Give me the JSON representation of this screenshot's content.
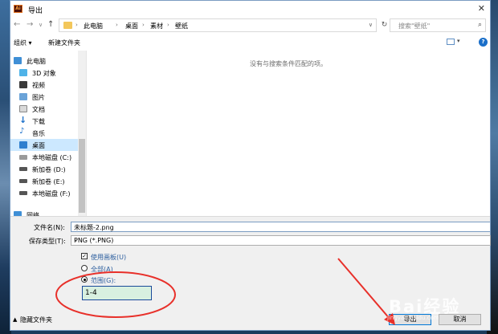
{
  "window": {
    "title": "导出",
    "app_icon": "Ai",
    "close_icon": "✕"
  },
  "address": {
    "crumbs": [
      "此电脑",
      "桌面",
      "素材",
      "壁纸"
    ],
    "search_placeholder": "搜索\"壁纸\""
  },
  "toolbar": {
    "organize": "组织 ▾",
    "new_folder": "新建文件夹"
  },
  "sidebar": {
    "items": [
      {
        "label": "此电脑",
        "icon": "computer-icon"
      },
      {
        "label": "3D 对象",
        "icon": "cube-icon"
      },
      {
        "label": "视频",
        "icon": "video-icon"
      },
      {
        "label": "图片",
        "icon": "picture-icon"
      },
      {
        "label": "文档",
        "icon": "document-icon"
      },
      {
        "label": "下载",
        "icon": "download-icon"
      },
      {
        "label": "音乐",
        "icon": "music-icon"
      },
      {
        "label": "桌面",
        "icon": "desktop-icon"
      },
      {
        "label": "本地磁盘 (C:)",
        "icon": "drive-icon"
      },
      {
        "label": "新加卷 (D:)",
        "icon": "drive-icon"
      },
      {
        "label": "新加卷 (E:)",
        "icon": "drive-icon"
      },
      {
        "label": "本地磁盘 (F:)",
        "icon": "drive-icon"
      },
      {
        "label": "网络",
        "icon": "network-icon"
      }
    ],
    "selected_index": 7
  },
  "content": {
    "empty_message": "没有与搜索条件匹配的项。"
  },
  "form": {
    "filename_label": "文件名(N):",
    "filename_value": "未标题-2.png",
    "filetype_label": "保存类型(T):",
    "filetype_value": "PNG (*.PNG)",
    "use_artboards_label": "使用画板(U)",
    "all_label": "全部(A)",
    "range_label": "范围(G):",
    "range_value": "1-4"
  },
  "footer": {
    "hide_folders": "隐藏文件夹",
    "export_button": "导出",
    "cancel_button": "取消"
  },
  "watermark": {
    "text": "Bai经验",
    "url": "jingyan.baidu.com"
  },
  "colors": {
    "accent": "#0078d7",
    "annotation_red": "#e8302a",
    "selection": "#cce8ff"
  }
}
